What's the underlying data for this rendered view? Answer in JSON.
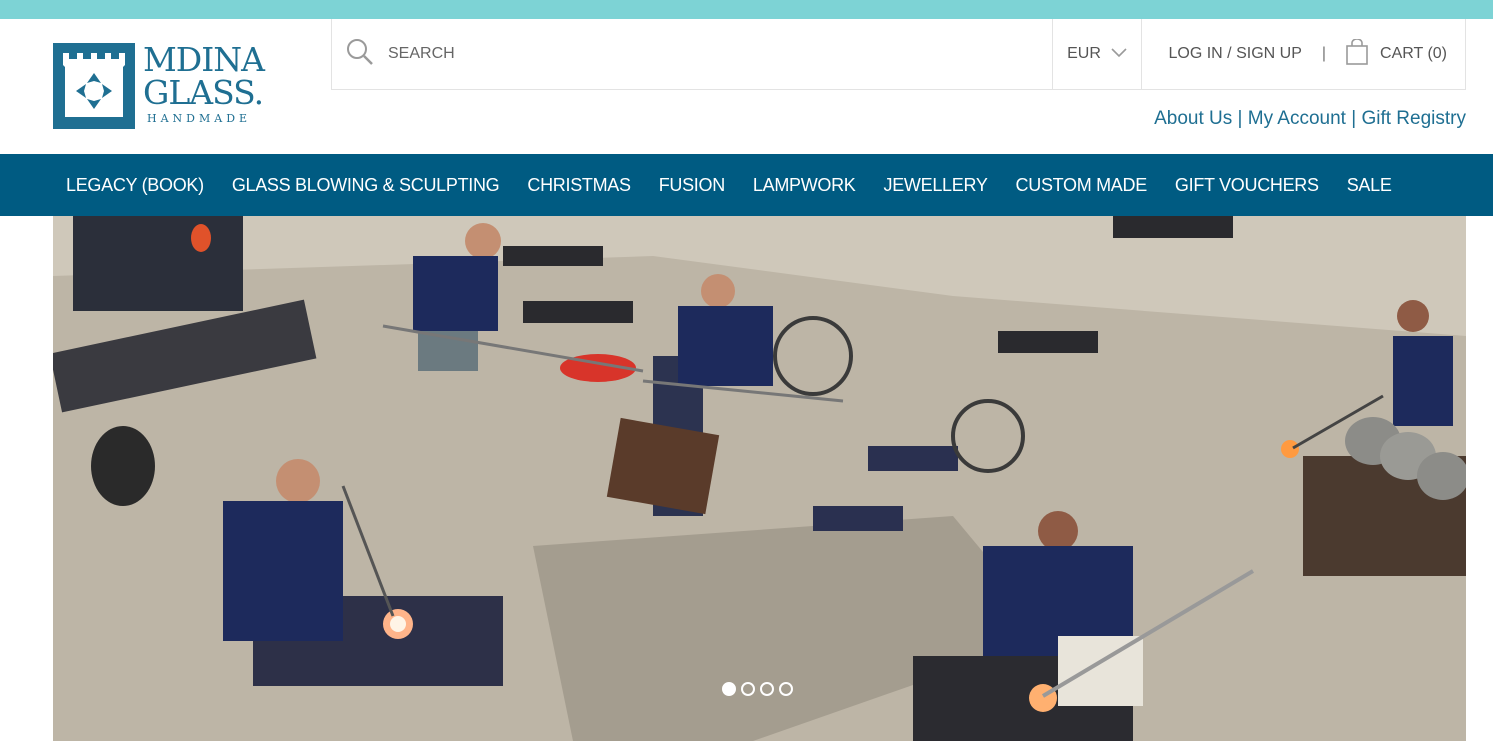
{
  "brand": {
    "name_line1": "MDINA",
    "name_line2": "GLASS.",
    "tagline": "HANDMADE"
  },
  "header": {
    "search_placeholder": "SEARCH",
    "currency": "EUR",
    "login": "LOG IN / SIGN UP",
    "separator": "|",
    "cart": "CART (0)"
  },
  "sub_links": {
    "about": "About Us",
    "account": "My Account",
    "registry": "Gift Registry",
    "divider": " | "
  },
  "nav": {
    "items": [
      "LEGACY (BOOK)",
      "GLASS BLOWING & SCULPTING",
      "CHRISTMAS",
      "FUSION",
      "LAMPWORK",
      "JEWELLERY",
      "CUSTOM MADE",
      "GIFT VOUCHERS",
      "SALE"
    ]
  },
  "hero": {
    "slide_count": 4,
    "active_slide": 1
  },
  "colors": {
    "top_strip": "#7dd3d5",
    "brand_blue": "#1f6f92",
    "nav_bg": "#005b82"
  }
}
